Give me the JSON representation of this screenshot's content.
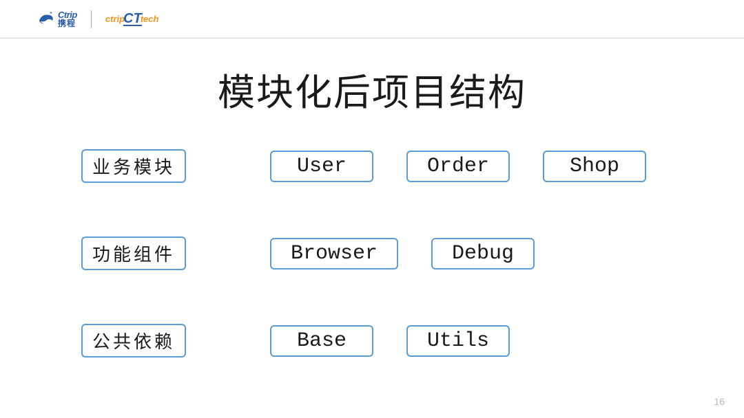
{
  "header": {
    "logo1_top": "Ctrip",
    "logo1_bottom": "携程",
    "logo2_left": "ctrip",
    "logo2_mid": "CT",
    "logo2_right": "tech"
  },
  "title": "模块化后项目结构",
  "rows": [
    {
      "label": "业务模块",
      "boxes": [
        "User",
        "Order",
        "Shop"
      ]
    },
    {
      "label": "功能组件",
      "boxes": [
        "Browser",
        "Debug"
      ]
    },
    {
      "label": "公共依赖",
      "boxes": [
        "Base",
        "Utils"
      ]
    }
  ],
  "page_number": "16"
}
